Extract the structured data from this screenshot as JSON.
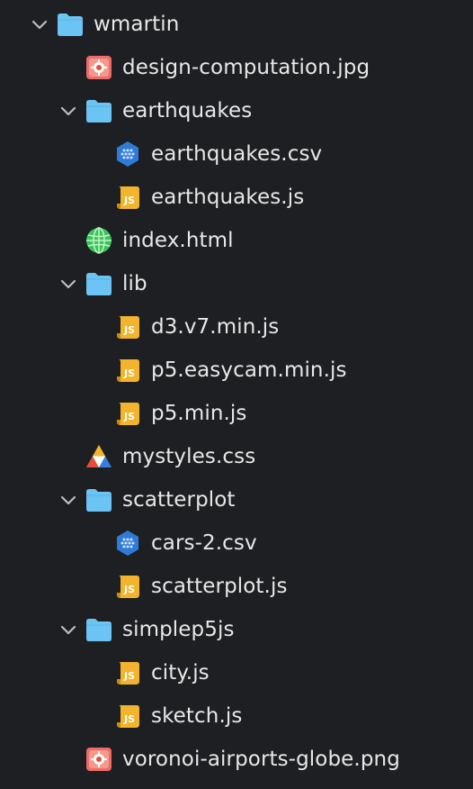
{
  "tree": {
    "root": {
      "label": "wmartin",
      "expanded": true,
      "icon": "folder-icon"
    },
    "items": [
      {
        "label": "design-computation.jpg",
        "icon": "image-icon"
      },
      {
        "label": "earthquakes",
        "icon": "folder-icon",
        "expanded": true
      },
      {
        "label": "earthquakes.csv",
        "icon": "csv-icon"
      },
      {
        "label": "earthquakes.js",
        "icon": "js-icon"
      },
      {
        "label": "index.html",
        "icon": "globe-icon"
      },
      {
        "label": "lib",
        "icon": "folder-icon",
        "expanded": true
      },
      {
        "label": "d3.v7.min.js",
        "icon": "js-icon"
      },
      {
        "label": "p5.easycam.min.js",
        "icon": "js-icon"
      },
      {
        "label": "p5.min.js",
        "icon": "js-icon"
      },
      {
        "label": "mystyles.css",
        "icon": "css-icon"
      },
      {
        "label": "scatterplot",
        "icon": "folder-icon",
        "expanded": true
      },
      {
        "label": "cars-2.csv",
        "icon": "csv-icon"
      },
      {
        "label": "scatterplot.js",
        "icon": "js-icon"
      },
      {
        "label": "simplep5js",
        "icon": "folder-icon",
        "expanded": true
      },
      {
        "label": "city.js",
        "icon": "js-icon"
      },
      {
        "label": "sketch.js",
        "icon": "js-icon"
      },
      {
        "label": "voronoi-airports-globe.png",
        "icon": "image-icon"
      }
    ]
  },
  "colors": {
    "background": "#1e1f22",
    "folder": "#6cc4f5",
    "js": "#f2b42c",
    "csv": "#2f7bd8",
    "image": "#f06a6a",
    "globe": "#3cc45a"
  }
}
